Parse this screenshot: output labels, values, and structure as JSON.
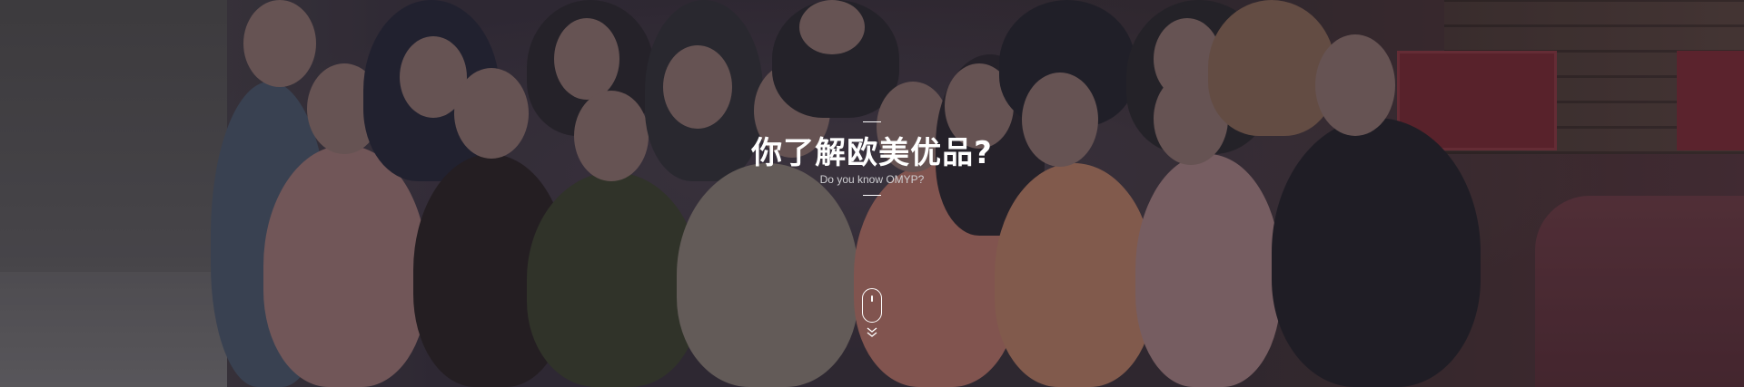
{
  "banner": {
    "title": "你了解欧美优品?",
    "subtitle": "Do you know OMYP?"
  },
  "scroll_hint": {
    "icon": "mouse-icon",
    "arrow_icon": "double-chevron-down-icon"
  },
  "colors": {
    "text": "#ffffff",
    "subtitle": "#cfcfd2",
    "overlay": "#19141e"
  }
}
